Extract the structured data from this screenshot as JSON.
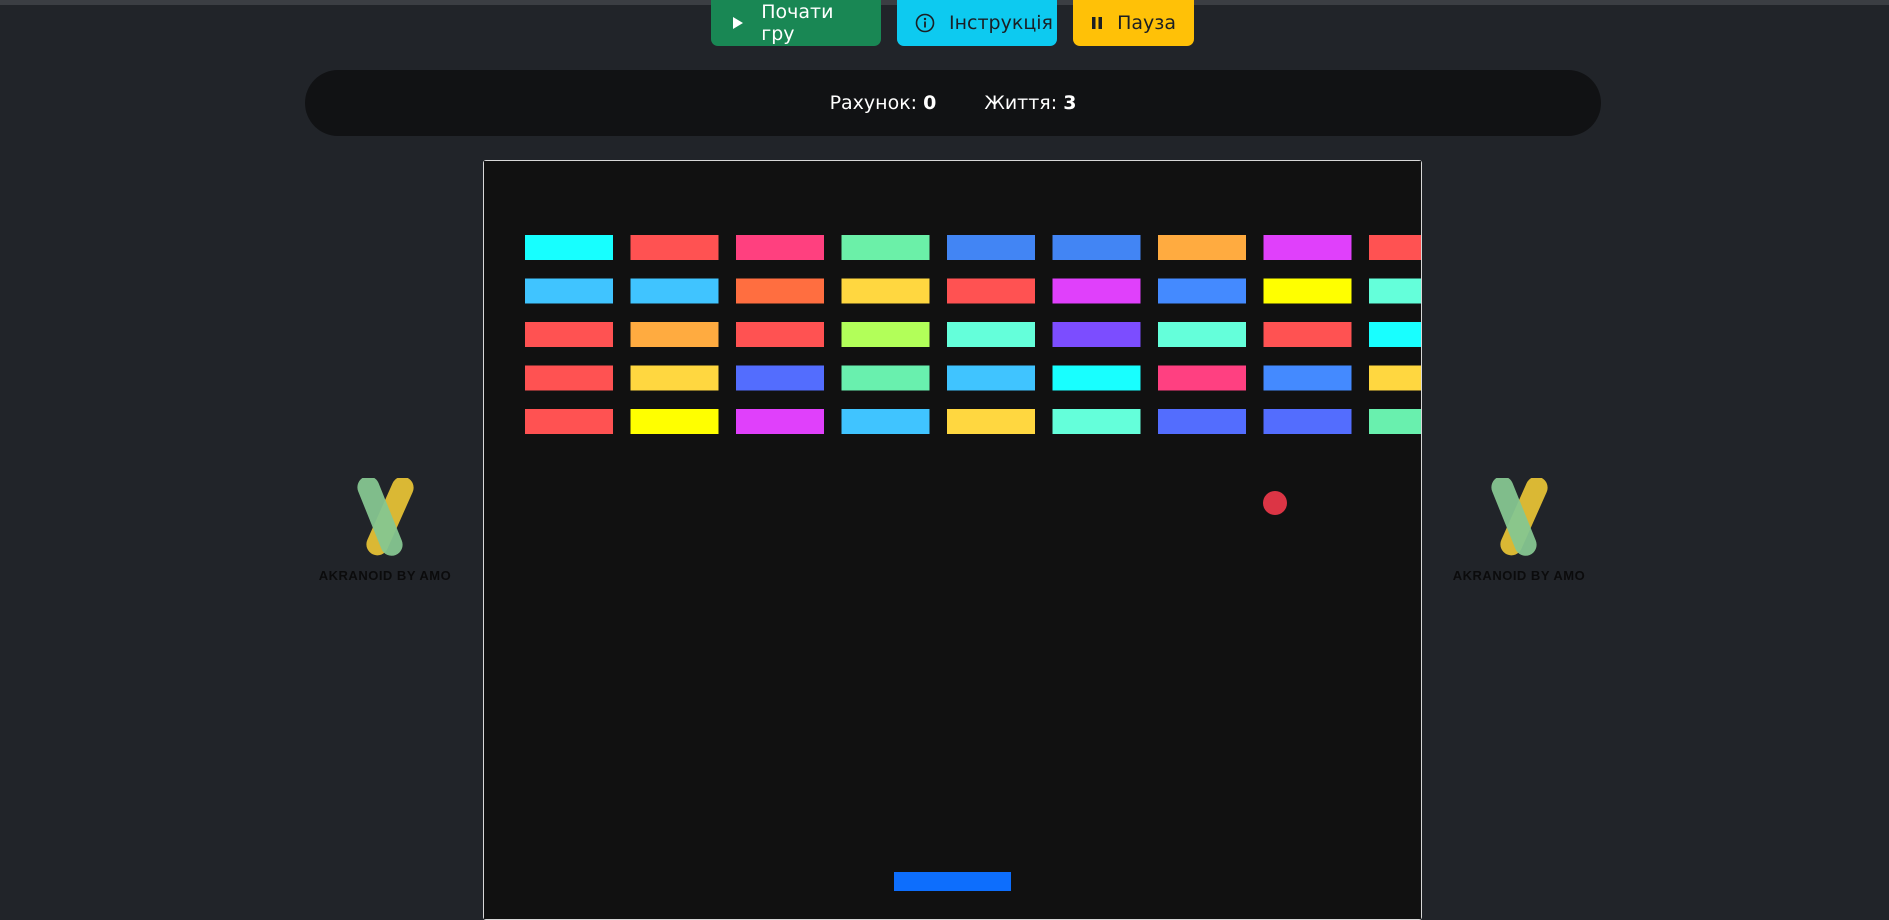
{
  "controls": {
    "start_label": "Почати гру",
    "help_label": "Інструкція",
    "pause_label": "Пауза"
  },
  "stats": {
    "score_label": "Рахунок:",
    "score_value": "0",
    "lives_label": "Життя:",
    "lives_value": "3"
  },
  "logo": {
    "caption": "AKRANOID BY AMO",
    "green": "#86c690",
    "yellow": "#eec935"
  },
  "game": {
    "board_bg": "#111111",
    "ball_color": "#dc3545",
    "paddle_color": "#0d6efd",
    "bricks": [
      [
        "#17ffff",
        "#ff5252",
        "#ff407f",
        "#6bf0a8",
        "#4285f4",
        "#4285f4",
        "#ffab40",
        "#e040fb",
        "#ff5252"
      ],
      [
        "#40c4ff",
        "#40c4ff",
        "#ff6e40",
        "#ffd740",
        "#ff5252",
        "#e040fb",
        "#448aff",
        "#ffff00",
        "#64ffda"
      ],
      [
        "#ff5252",
        "#ffab40",
        "#ff5252",
        "#b2ff59",
        "#64ffda",
        "#7c4dff",
        "#64ffda",
        "#ff5252",
        "#18ffff"
      ],
      [
        "#ff5252",
        "#ffd740",
        "#536dfe",
        "#69f0ae",
        "#40c4ff",
        "#18ffff",
        "#ff4081",
        "#448aff",
        "#ffd740"
      ],
      [
        "#ff5252",
        "#ffff00",
        "#e040fb",
        "#40c4ff",
        "#ffd740",
        "#64ffda",
        "#536dfe",
        "#536dfe",
        "#69f0ae"
      ]
    ]
  }
}
